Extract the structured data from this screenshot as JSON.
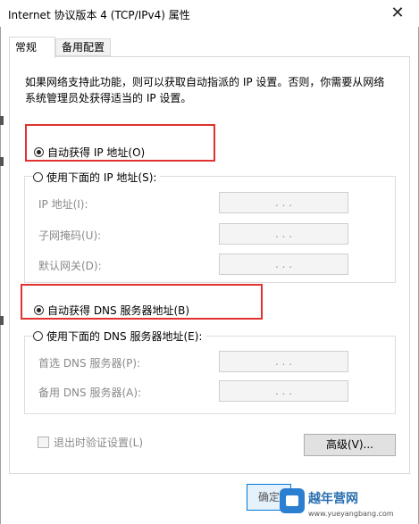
{
  "window": {
    "title": "Internet 协议版本 4 (TCP/IPv4) 属性",
    "close_glyph": "✕"
  },
  "tabs": [
    {
      "label": "常规",
      "active": true
    },
    {
      "label": "备用配置",
      "active": false
    }
  ],
  "description": "如果网络支持此功能，则可以获取自动指派的 IP 设置。否则，你需要从网络系统管理员处获得适当的 IP 设置。",
  "ip_section": {
    "auto_label": "自动获得 IP 地址(O)",
    "auto_selected": true,
    "manual_label": "使用下面的 IP 地址(S):",
    "manual_selected": false,
    "fields": [
      {
        "label": "IP 地址(I):",
        "value": ". . ."
      },
      {
        "label": "子网掩码(U):",
        "value": ". . ."
      },
      {
        "label": "默认网关(D):",
        "value": ". . ."
      }
    ]
  },
  "dns_section": {
    "auto_label": "自动获得 DNS 服务器地址(B)",
    "auto_selected": true,
    "manual_label": "使用下面的 DNS 服务器地址(E):",
    "manual_selected": false,
    "fields": [
      {
        "label": "首选 DNS 服务器(P):",
        "value": ". . ."
      },
      {
        "label": "备用 DNS 服务器(A):",
        "value": ". . ."
      }
    ]
  },
  "validate_checkbox": {
    "label": "退出时验证设置(L)",
    "checked": false,
    "enabled": false
  },
  "buttons": {
    "advanced": "高级(V)...",
    "ok": "确定"
  },
  "watermark": {
    "name": "越年营网",
    "url": "www.yueyangbang.com"
  },
  "colors": {
    "highlight": "#e0322f",
    "accent": "#0078d7"
  }
}
